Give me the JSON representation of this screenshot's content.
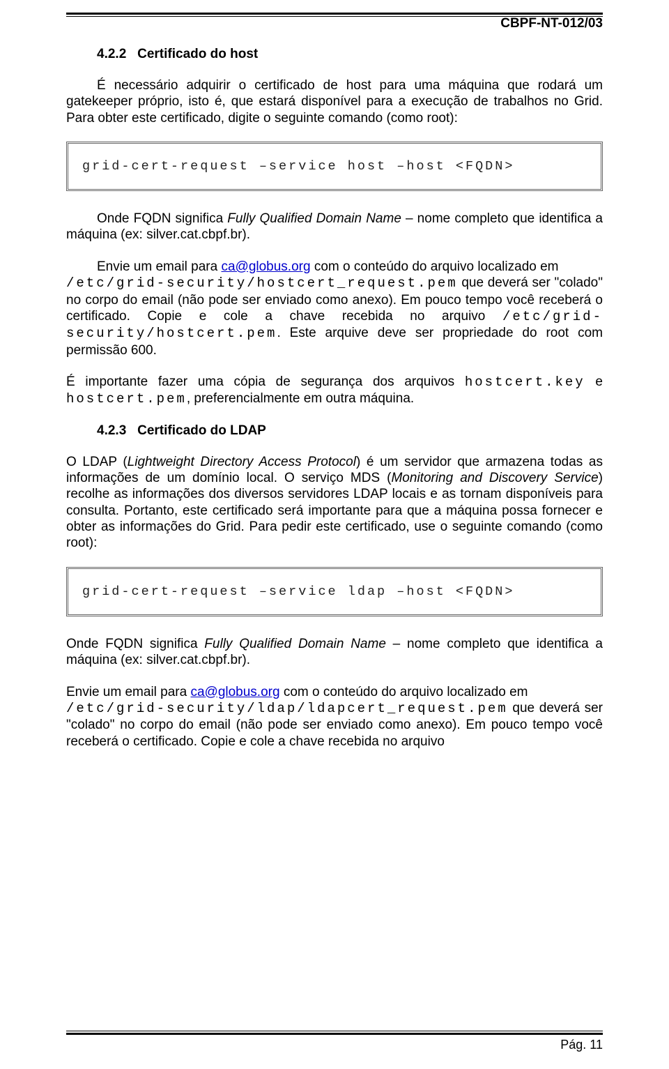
{
  "header": {
    "code": "CBPF-NT-012/03"
  },
  "sec1": {
    "num": "4.2.2",
    "title": "Certificado do host",
    "p1": "É necessário adquirir o certificado de host para uma máquina que rodará um gatekeeper próprio, isto é, que estará disponível para a execução de trabalhos no Grid. Para obter este certificado, digite o seguinte comando (como root):",
    "cmd": "grid-cert-request –service host –host <FQDN>",
    "p2a": "Onde FQDN significa ",
    "p2b": "Fully Qualified Domain Name",
    "p2c": " – nome completo que identifica a máquina (ex: silver.cat.cbpf.br).",
    "p3a": "Envie um email para  ",
    "p3link": "ca@globus.org",
    "p3b": " com o conteúdo do arquivo localizado em ",
    "p3code1": "/etc/grid-security/hostcert_request.pem",
    "p3c": " que deverá ser \"colado\" no corpo do email (não pode ser enviado como anexo). Em pouco tempo você receberá o certificado. Copie e cole a chave recebida no arquivo ",
    "p3code2": "/etc/grid-security/hostcert.pem",
    "p3d": ". Este arquive deve ser propriedade do root com permissão 600.",
    "p4a": "É importante fazer uma cópia de segurança dos arquivos ",
    "p4code1": "hostcert.key",
    "p4b": " e ",
    "p4code2": "hostcert.pem",
    "p4c": ", preferencialmente em outra máquina."
  },
  "sec2": {
    "num": "4.2.3",
    "title": "Certificado do LDAP",
    "p1a": "O LDAP (",
    "p1b": "Lightweight Directory Access Protocol",
    "p1c": ") é um servidor que armazena todas as informações de um domínio local. O serviço MDS (",
    "p1d": "Monitoring and Discovery Service",
    "p1e": ") recolhe as informações  dos diversos servidores LDAP locais e as tornam disponíveis para consulta. Portanto, este certificado será importante para que a máquina possa fornecer e obter as informações do Grid. Para pedir este certificado, use o seguinte comando (como root):",
    "cmd": "grid-cert-request –service ldap –host <FQDN>",
    "p2a": "Onde FQDN significa ",
    "p2b": "Fully Qualified Domain Name",
    "p2c": " – nome completo que identifica a máquina (ex: silver.cat.cbpf.br).",
    "p3a": "Envie um email para ",
    "p3link": "ca@globus.org",
    "p3b": " com o conteúdo do arquivo localizado em",
    "p3code": "/etc/grid-security/ldap/ldapcert_request.pem",
    "p3c": " que deverá ser \"colado\" no corpo do email (não pode ser enviado como anexo). Em pouco tempo você receberá o certificado. Copie e cole a chave recebida no arquivo"
  },
  "footer": {
    "page": "Pág. 11"
  }
}
